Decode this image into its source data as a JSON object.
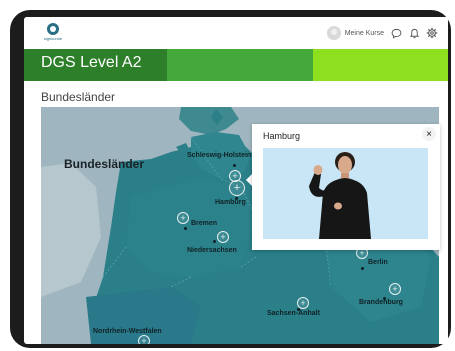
{
  "app": {
    "logo_text": "signkunde",
    "user_label": "Meine Kurse"
  },
  "course": {
    "title": "DGS Level A2"
  },
  "page": {
    "title": "Bundesländer"
  },
  "map": {
    "heading": "Bundesländer",
    "cities": [
      {
        "label": "Schleswig-Holstein"
      },
      {
        "label": "Hamburg"
      },
      {
        "label": "Bremen"
      },
      {
        "label": "Niedersachsen"
      },
      {
        "label": "Berlin"
      },
      {
        "label": "Brandenburg"
      },
      {
        "label": "Sachsen-Anhalt"
      },
      {
        "label": "Nordrhein-Westfalen"
      }
    ]
  },
  "popup": {
    "title": "Hamburg",
    "close_symbol": "×"
  },
  "icons": {
    "chat": "chat-icon",
    "bell": "bell-icon",
    "settings": "gear-icon"
  },
  "colors": {
    "banner_dark": "#2d7f2a",
    "banner_mid": "#44a83a",
    "banner_light": "#8ee01f",
    "land": "#2a7f88",
    "water": "#9fb6c0"
  }
}
